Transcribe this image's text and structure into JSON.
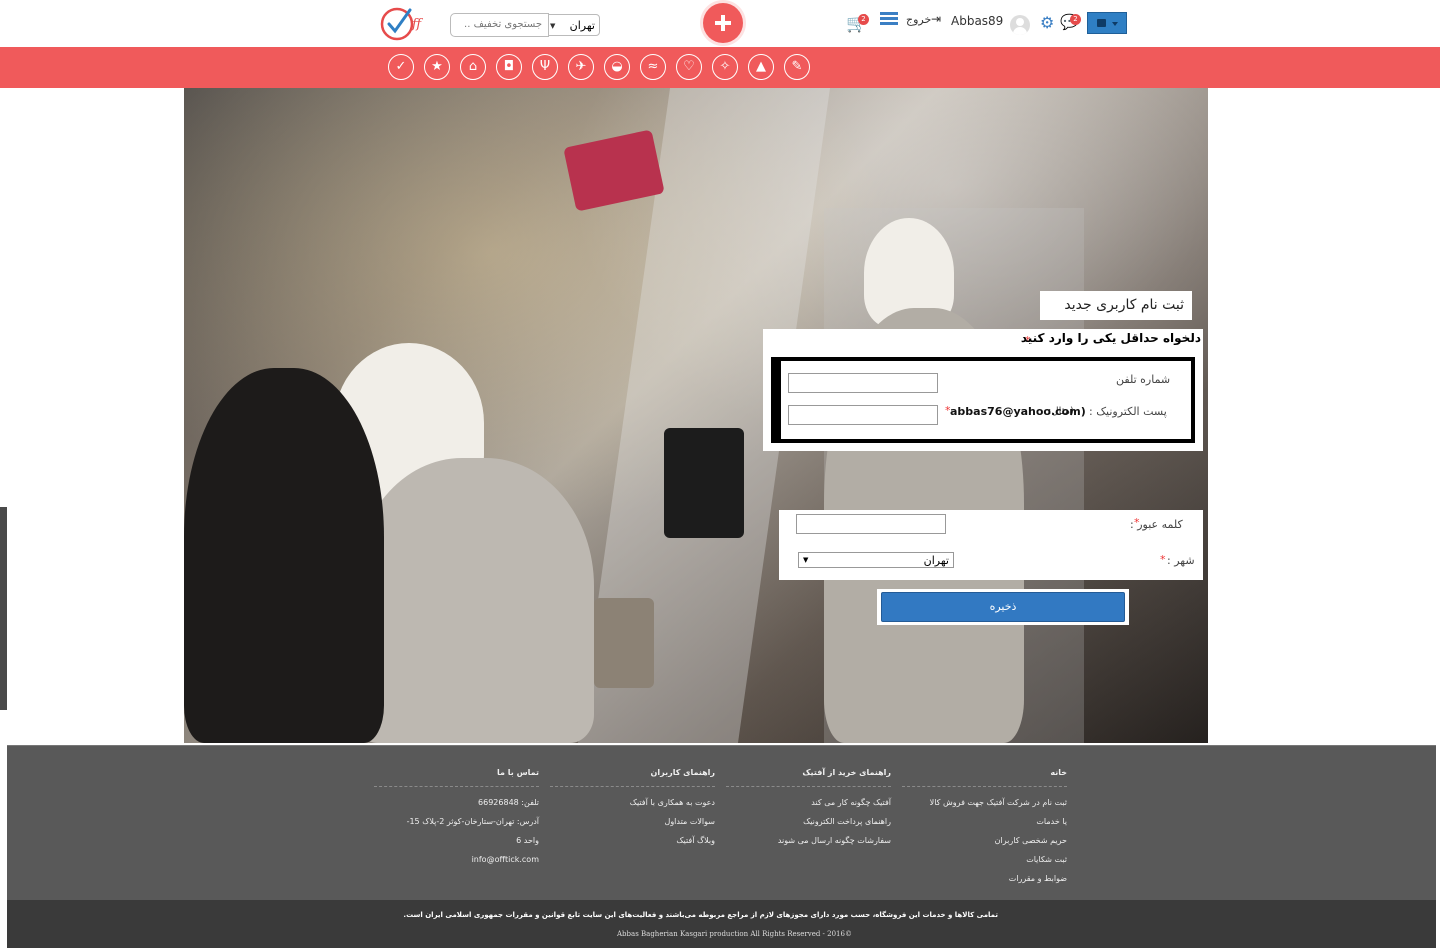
{
  "header": {
    "city": "تهران",
    "search_placeholder": "جستجوی تخفیف ..",
    "cart_count": "2",
    "logout_label": "خروج",
    "username": "Abbas89",
    "messages_count": "2",
    "colors": {
      "accent": "#f05a5b",
      "primary": "#3279c2"
    }
  },
  "categories": [
    {
      "name": "check-icon",
      "glyph": "✓"
    },
    {
      "name": "star-icon",
      "glyph": "★"
    },
    {
      "name": "building-icon",
      "glyph": "⌂"
    },
    {
      "name": "car-icon",
      "glyph": "◘"
    },
    {
      "name": "restaurant-icon",
      "glyph": "Ψ"
    },
    {
      "name": "plane-icon",
      "glyph": "✈"
    },
    {
      "name": "food-icon",
      "glyph": "◒"
    },
    {
      "name": "swim-icon",
      "glyph": "≈"
    },
    {
      "name": "heartbeat-icon",
      "glyph": "♡"
    },
    {
      "name": "gift-icon",
      "glyph": "✧"
    },
    {
      "name": "graduation-icon",
      "glyph": "▲"
    },
    {
      "name": "beauty-icon",
      "glyph": "✎"
    }
  ],
  "form": {
    "title": "ثبت نام کاربری جدید",
    "subtitle": "دلخواه حداقل یکی را وارد کنید",
    "required_mark": "*",
    "phone_label": "شماره تلفن",
    "email_label": "پست الکترونیک :",
    "email_hint_prefix": "(مثال:",
    "email_hint": "abbas76@yahoo.com)",
    "password_label": "کلمه عبور :",
    "city_label": "شهر :",
    "city_value": "تهران",
    "save_label": "ذخیره"
  },
  "footer": {
    "columns": [
      {
        "title": "خانه",
        "items": [
          "ثبت نام در شرکت آفتیک جهت فروش کالا",
          "یا خدمات",
          "حریم شخصی کاربران",
          "ثبت شکایات",
          "ضوابط و مقررات"
        ]
      },
      {
        "title": "راهنمای خرید از آفتیک",
        "items": [
          "آفتیک چگونه کار می کند",
          "راهنمای پرداخت الکترونیک",
          "سفارشات چگونه ارسال می شوند"
        ]
      },
      {
        "title": "راهنمای کاربران",
        "items": [
          "دعوت به همکاری با آفتیک",
          "سوالات متداول",
          "وبلاگ آفتیک"
        ]
      },
      {
        "title": "تماس با ما",
        "items": [
          "تلفن: 66926848",
          "آدرس: تهران-ستارخان-کوثر 2-پلاک 15-",
          "واحد 6",
          "info@offtick.com"
        ]
      }
    ],
    "legal": "تمامی کالاها و خدمات این فروشگاه، حسب مورد دارای مجوزهای لازم از مراجع مربوطه می‌باشند و فعالیت‌های این سایت تابع قوانین و مقررات جمهوری اسلامی ایران است.",
    "copyright": "Abbas Bagherian Kasgari production All Rights Reserved - 2016©"
  }
}
